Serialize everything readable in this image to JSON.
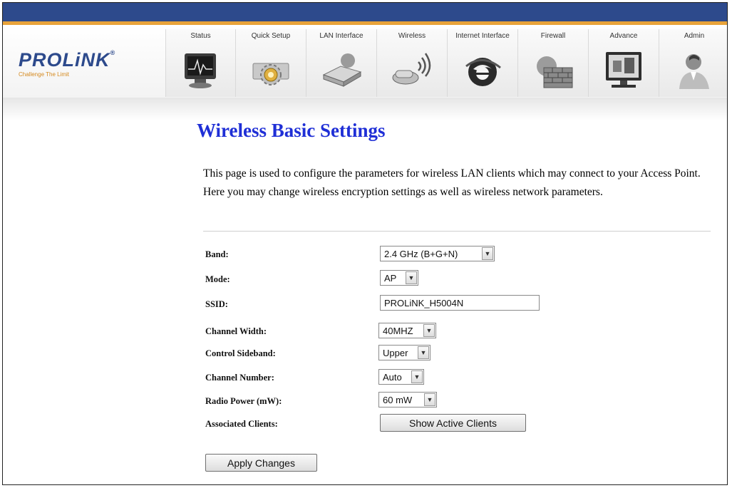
{
  "brand": {
    "name": "PROLiNK",
    "registered": "®",
    "tagline": "Challenge The Limit"
  },
  "nav": {
    "items": [
      {
        "label": "Status",
        "icon": "monitor-icon"
      },
      {
        "label": "Quick Setup",
        "icon": "gear-icon"
      },
      {
        "label": "LAN Interface",
        "icon": "router-icon"
      },
      {
        "label": "Wireless",
        "icon": "wireless-adapter-icon"
      },
      {
        "label": "Internet Interface",
        "icon": "internet-globe-icon"
      },
      {
        "label": "Firewall",
        "icon": "firewall-icon"
      },
      {
        "label": "Advance",
        "icon": "tv-screen-icon"
      },
      {
        "label": "Admin",
        "icon": "person-icon"
      }
    ]
  },
  "page": {
    "title": "Wireless Basic Settings",
    "description": "This page is used to configure the parameters for wireless LAN clients which may connect to your Access Point. Here you may change wireless encryption settings as well as wireless network parameters."
  },
  "form": {
    "band": {
      "label": "Band:",
      "value": "2.4 GHz (B+G+N)"
    },
    "mode": {
      "label": "Mode:",
      "value": "AP"
    },
    "ssid": {
      "label": "SSID:",
      "value": "PROLiNK_H5004N"
    },
    "channel_width": {
      "label": "Channel Width:",
      "value": "40MHZ"
    },
    "control_sideband": {
      "label": "Control Sideband:",
      "value": "Upper"
    },
    "channel_number": {
      "label": "Channel Number:",
      "value": "Auto"
    },
    "radio_power": {
      "label": "Radio Power (mW):",
      "value": "60 mW"
    },
    "associated_clients": {
      "label": "Associated Clients:",
      "button": "Show Active Clients"
    },
    "apply_button": "Apply Changes"
  },
  "colors": {
    "top_bar": "#2d4a8c",
    "accent_stripe": "#e8a33a",
    "title": "#1f2fd6",
    "brand": "#2d4a8c"
  }
}
